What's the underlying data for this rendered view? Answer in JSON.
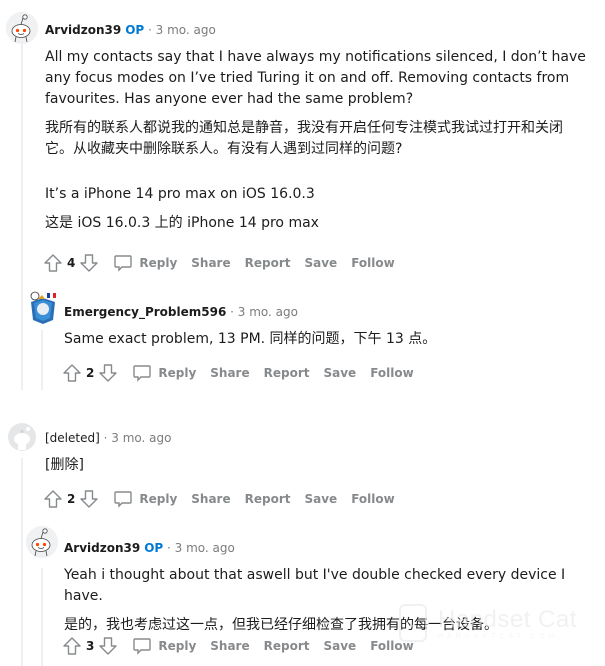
{
  "comments": [
    {
      "author": "Arvidzon39",
      "op_badge": "OP",
      "time": "· 3 mo. ago",
      "avatar": "snoo-avatar",
      "paragraphs": [
        "All my contacts say that I have always my notifications silenced, I don’t have any focus modes on I’ve tried Turing it on and off. Removing contacts from favourites. Has anyone ever had the same problem?",
        "我所有的联系人都说我的通知总是静音，我没有开启任何专注模式我试过打开和关闭它。从收藏夹中删除联系人。有没有人遇到过同样的问题?",
        "It’s a iPhone 14 pro max on iOS 16.0.3",
        "这是 iOS 16.0.3 上的 iPhone 14 pro max"
      ],
      "votes": "4"
    },
    {
      "author": "Emergency_Problem596",
      "time": "· 3 mo. ago",
      "avatar": "custom-avatar",
      "paragraphs": [
        "Same exact problem, 13 PM. 同样的问题，下午 13 点。"
      ],
      "votes": "2"
    },
    {
      "author": "[deleted]",
      "time": "· 3 mo. ago",
      "avatar": "deleted-avatar",
      "paragraphs": [
        "[删除]"
      ],
      "votes": "2"
    },
    {
      "author": "Arvidzon39",
      "op_badge": "OP",
      "time": "· 3 mo. ago",
      "avatar": "snoo-avatar",
      "paragraphs": [
        "Yeah i thought about that aswell but I've double checked every device I have.",
        "是的，我也考虑过这一点，但我已经仔细检查了我拥有的每一台设备。"
      ],
      "votes": "3"
    }
  ],
  "actions": {
    "reply": "Reply",
    "share": "Share",
    "report": "Report",
    "save": "Save",
    "follow": "Follow"
  },
  "watermark": {
    "title": "Handset Cat",
    "subtitle": "HANDSETCAT.COM"
  },
  "colors": {
    "op_badge": "#0079d3",
    "meta_gray": "#7c7c7c",
    "action_gray": "#878a8c",
    "thread_line": "#edeff1"
  }
}
